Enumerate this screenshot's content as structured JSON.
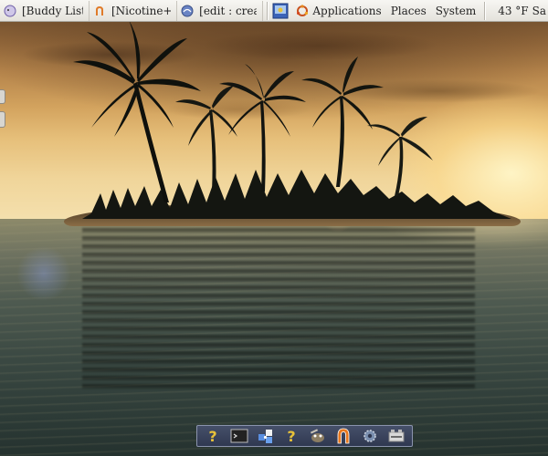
{
  "top_panel": {
    "tasks": [
      {
        "label": "[Buddy List]",
        "icon": "pidgin-icon"
      },
      {
        "label": "[Nicotine+ L...",
        "icon": "nicotine-icon"
      },
      {
        "label": "[edit : creati...",
        "icon": "editor-icon"
      }
    ],
    "launcher_icon": "screenshot-icon",
    "menus": {
      "applications": "Applications",
      "places": "Places",
      "system": "System"
    },
    "weather": {
      "temperature": "43 °F",
      "extra": "Sa"
    }
  },
  "dock": {
    "items": [
      "help-icon",
      "terminal-icon",
      "puzzle-icon",
      "help-icon",
      "gimp-icon",
      "magnet-icon",
      "settings-icon",
      "drive-icon"
    ]
  },
  "colors": {
    "panel_bg": "#eceae4",
    "dock_bg": "#3a4360",
    "accent_orange": "#e8781e"
  }
}
